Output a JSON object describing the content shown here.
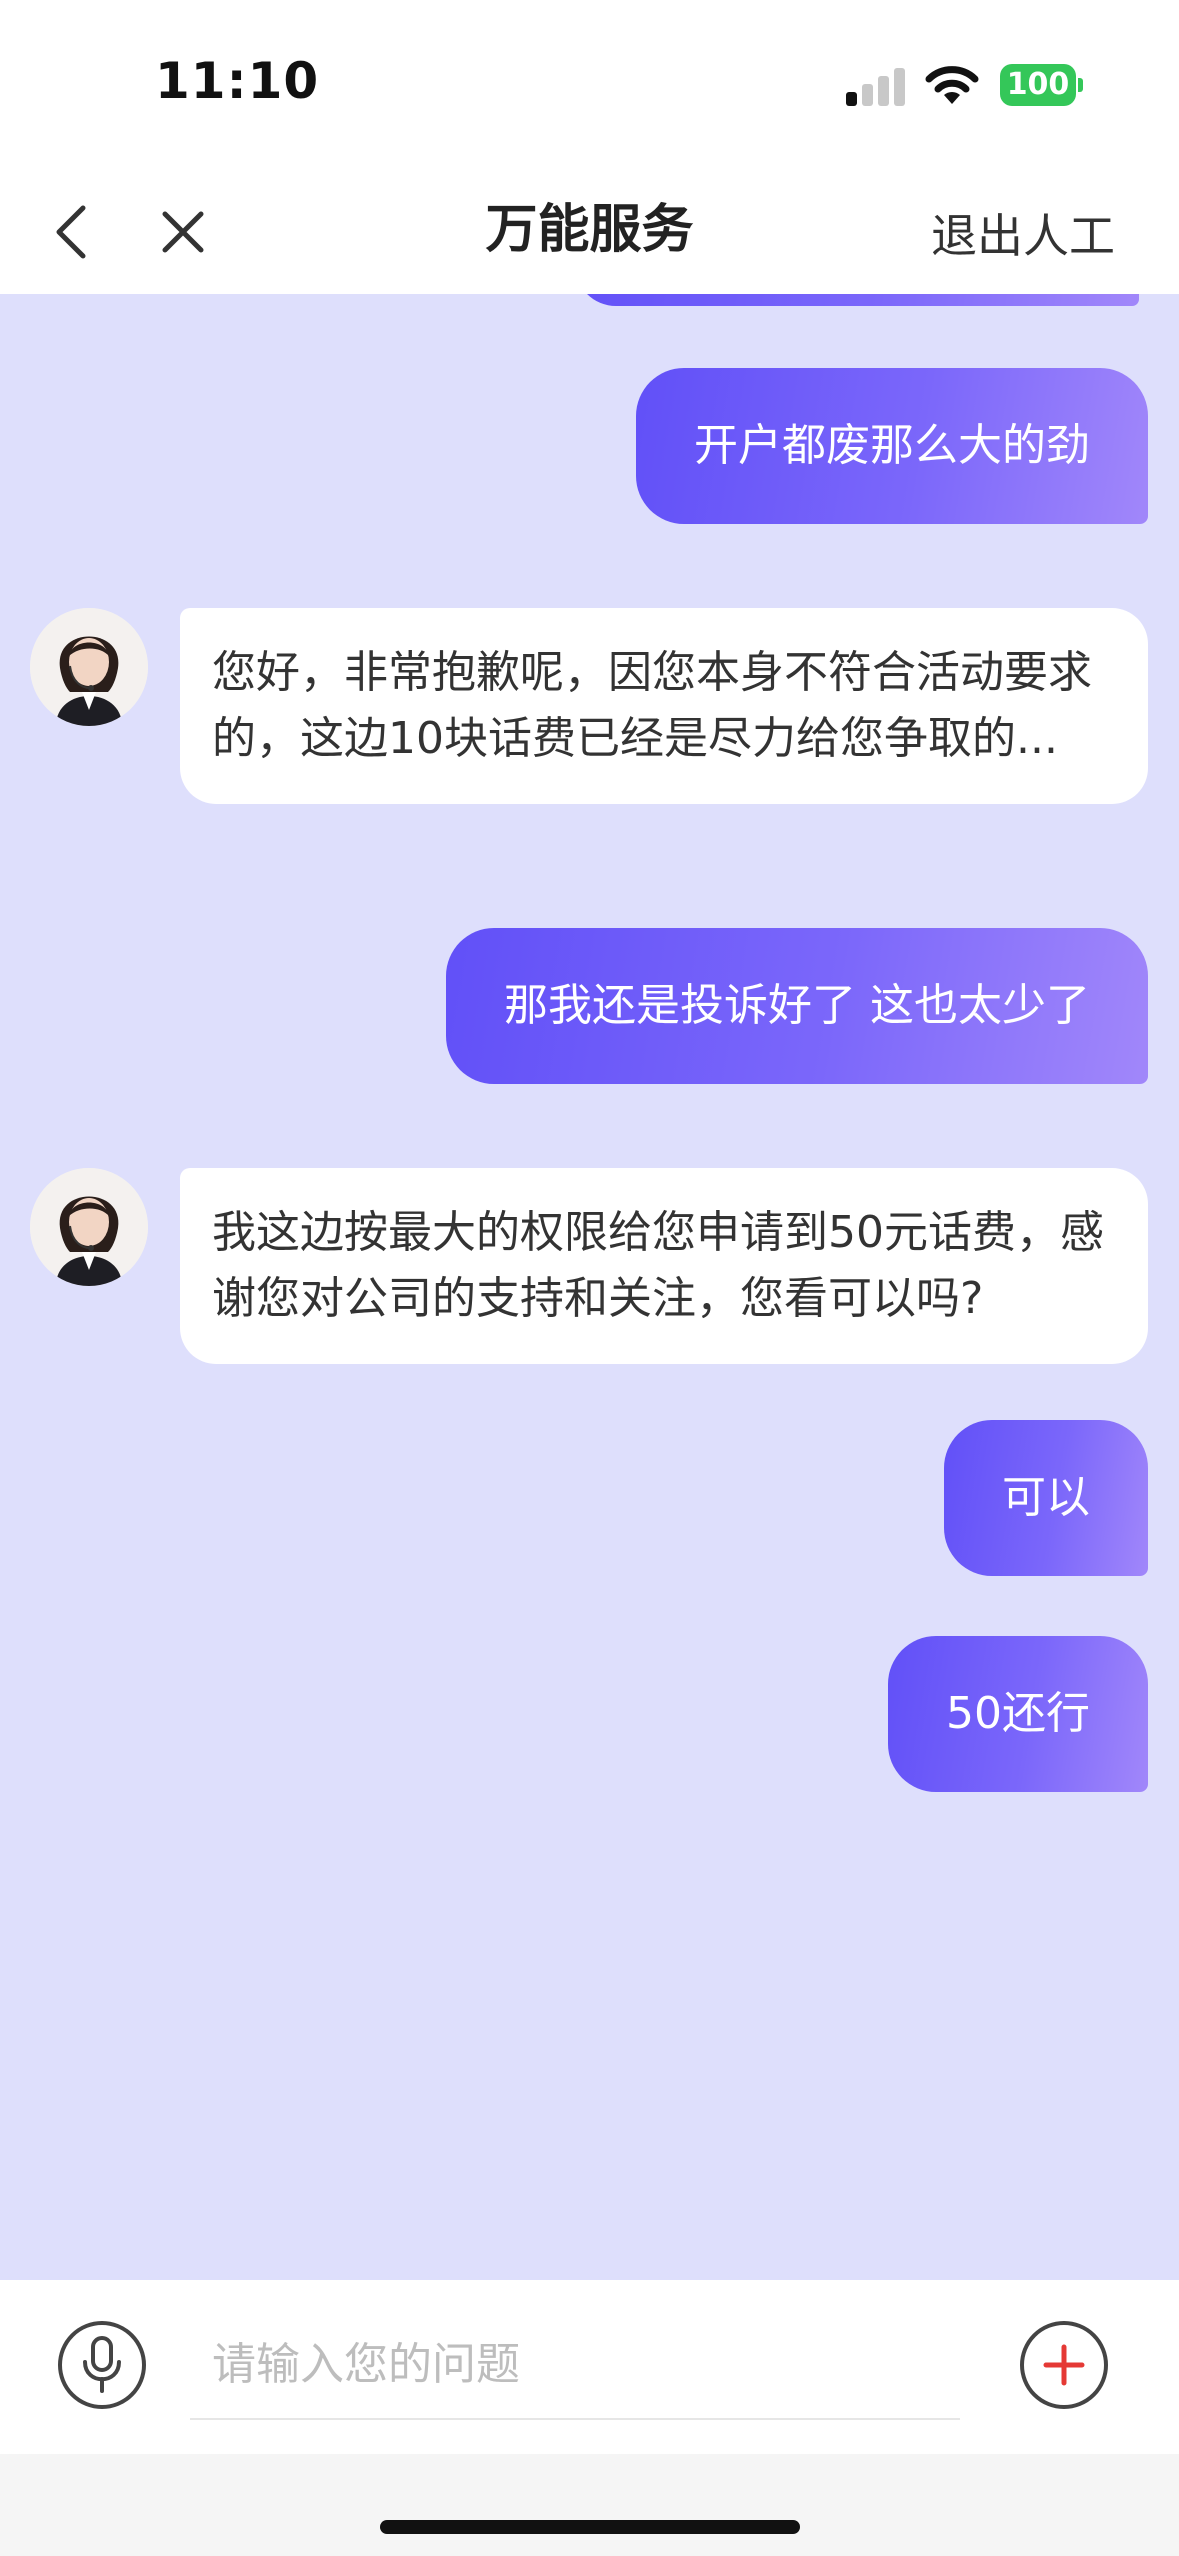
{
  "status_bar": {
    "time": "11:10",
    "battery": "100"
  },
  "nav": {
    "title": "万能服务",
    "exit_label": "退出人工"
  },
  "messages": [
    {
      "role": "user",
      "text": "开户都废那么大的劲"
    },
    {
      "role": "agent",
      "text": "您好，非常抱歉呢，因您本身不符合活动要求的，这边10块话费已经是尽力给您争取的..."
    },
    {
      "role": "user",
      "text": "那我还是投诉好了 这也太少了"
    },
    {
      "role": "agent",
      "text": "我这边按最大的权限给您申请到50元话费，感谢您对公司的支持和关注，您看可以吗?"
    },
    {
      "role": "user",
      "text": "可以"
    },
    {
      "role": "user",
      "text": "50还行"
    }
  ],
  "input": {
    "placeholder": "请输入您的问题"
  },
  "colors": {
    "chat_background": "#dedffc",
    "user_bubble_start": "#6150f8",
    "user_bubble_end": "#a187fa",
    "add_icon": "#e53935"
  },
  "icons": [
    "back-chevron",
    "close",
    "microphone",
    "add",
    "agent-avatar"
  ]
}
